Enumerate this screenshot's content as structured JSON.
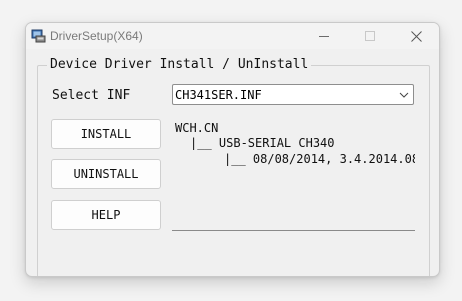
{
  "window": {
    "title": "DriverSetup(X64)"
  },
  "group": {
    "title": "Device Driver Install / UnInstall"
  },
  "inf": {
    "label": "Select INF",
    "selected": "CH341SER.INF"
  },
  "buttons": {
    "install": "INSTALL",
    "uninstall": "UNINSTALL",
    "help": "HELP"
  },
  "info": {
    "lines": [
      "WCH.CN",
      "|__ USB-SERIAL CH340",
      "|__ 08/08/2014, 3.4.2014.08"
    ]
  },
  "icons": {
    "app": "driver-setup-icon",
    "minimize": "minimize-icon",
    "maximize": "maximize-icon",
    "close": "close-icon",
    "dropdown": "chevron-down-icon"
  }
}
